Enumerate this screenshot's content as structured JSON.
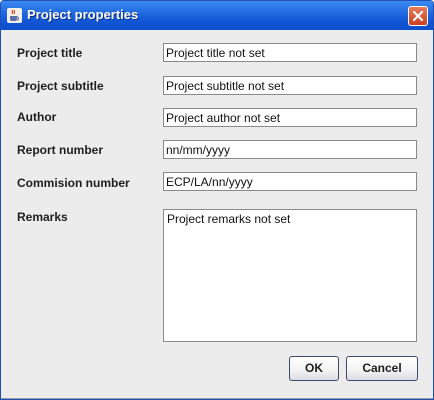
{
  "window": {
    "title": "Project properties",
    "icon": "java-cup-icon",
    "close_icon": "close-icon"
  },
  "form": {
    "fields": [
      {
        "label": "Project title",
        "value": "Project title not set"
      },
      {
        "label": "Project subtitle",
        "value": "Project subtitle not set"
      },
      {
        "label": "Author",
        "value": "Project author not set"
      },
      {
        "label": "Report number",
        "value": "nn/mm/yyyy"
      },
      {
        "label": "Commision number",
        "value": "ECP/LA/nn/yyyy"
      }
    ],
    "remarks": {
      "label": "Remarks",
      "value": "Project remarks not set"
    }
  },
  "buttons": {
    "ok": "OK",
    "cancel": "Cancel"
  },
  "colors": {
    "titlebar": "#1f66de",
    "background": "#ececec",
    "close_button": "#c9401f"
  }
}
